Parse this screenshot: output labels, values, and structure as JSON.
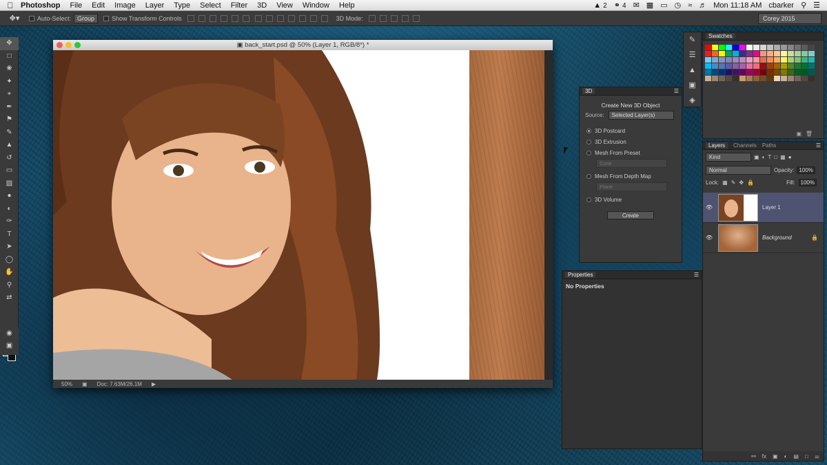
{
  "menubar": {
    "apple_icon": "apple-logo",
    "app_name": "Photoshop",
    "menus": [
      "File",
      "Edit",
      "Image",
      "Layer",
      "Type",
      "Select",
      "Filter",
      "3D",
      "View",
      "Window",
      "Help"
    ],
    "status": {
      "adobe_count": "2",
      "cc_count": "4",
      "clock": "Mon 11:18 AM",
      "user": "cbarker"
    }
  },
  "options_bar": {
    "auto_select_label": "Auto-Select:",
    "auto_select_value": "Group",
    "transform_label": "Show Transform Controls",
    "mode_3d_label": "3D Mode:",
    "workspace": "Corey 2015"
  },
  "document": {
    "title": "back_start.psd @ 50% (Layer 1, RGB/8*) *",
    "zoom": "50%",
    "doc_size": "Doc: 7.63M/26.1M"
  },
  "panel_3d": {
    "tab": "3D",
    "heading": "Create New 3D Object",
    "source_label": "Source:",
    "source_value": "Selected Layer(s)",
    "options": [
      {
        "label": "3D Postcard",
        "selected": true
      },
      {
        "label": "3D Extrusion",
        "selected": false
      },
      {
        "label": "Mesh From Preset",
        "selected": false
      },
      {
        "label": "Mesh From Depth Map",
        "selected": false
      },
      {
        "label": "3D Volume",
        "selected": false
      }
    ],
    "preset_value": "Cone",
    "depth_value": "Plane",
    "create_button": "Create"
  },
  "properties": {
    "tab": "Properties",
    "message": "No Properties"
  },
  "swatches": {
    "tab": "Swatches"
  },
  "layers_panel": {
    "tabs": [
      "Layers",
      "Channels",
      "Paths"
    ],
    "kind_value": "Kind",
    "blend_mode": "Normal",
    "opacity_label": "Opacity:",
    "opacity_value": "100%",
    "lock_label": "Lock:",
    "fill_label": "Fill:",
    "fill_value": "100%",
    "layers": [
      {
        "name": "Layer 1",
        "selected": true
      },
      {
        "name": "Background",
        "selected": false,
        "locked": true
      }
    ]
  },
  "colors": {
    "foreground": "#35a52c",
    "background": "#111111",
    "selection": "#4d5370"
  }
}
